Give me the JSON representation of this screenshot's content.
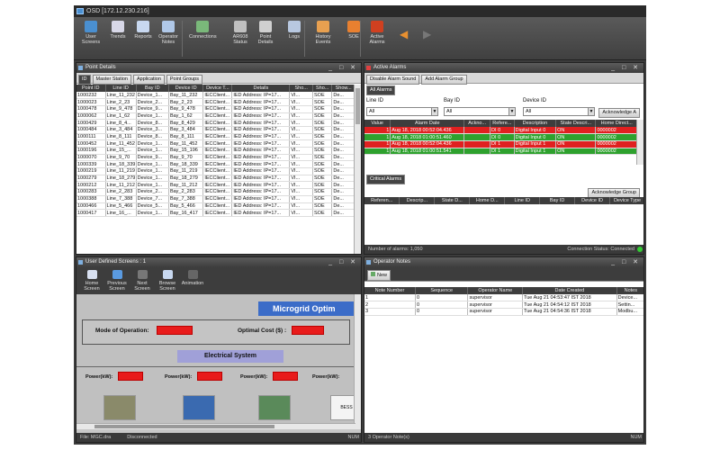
{
  "window": {
    "title": "OSD [172.12.230.216]"
  },
  "toolbar": {
    "items": [
      {
        "label": "User Screens",
        "icon": "user-screens-icon",
        "color": "#4a8fd0"
      },
      {
        "label": "Trends",
        "icon": "trends-icon",
        "color": "#d8d8e8"
      },
      {
        "label": "Reports",
        "icon": "reports-icon",
        "color": "#c8d8f0"
      },
      {
        "label": "Operator Notes",
        "icon": "notes-icon",
        "color": "#b0c8e8"
      },
      {
        "label": "Connections",
        "icon": "connections-icon",
        "color": "#7ab87a"
      },
      {
        "label": "AR608 Status",
        "icon": "status-icon",
        "color": "#c0c0c0"
      },
      {
        "label": "Point Details",
        "icon": "point-details-icon",
        "color": "#d0d0d0"
      },
      {
        "label": "Logs",
        "icon": "logs-icon",
        "color": "#b8c8e0"
      },
      {
        "label": "History Events",
        "icon": "history-icon",
        "color": "#e8a050"
      },
      {
        "label": "SOE",
        "icon": "soe-icon",
        "color": "#e88030"
      },
      {
        "label": "Active Alarms",
        "icon": "alarm-icon",
        "color": "#d04020"
      }
    ]
  },
  "point_details": {
    "title": "Point Details",
    "tabs": [
      "ID",
      "Master Station",
      "Application",
      "Point Groups"
    ],
    "columns": [
      "Point ID",
      "Line ID",
      "Bay ID",
      "Device ID",
      "Device T...",
      "Details",
      "Sho...",
      "Sho...",
      "Show..."
    ],
    "rows": [
      [
        "1000232",
        "Line_11_232",
        "Device_1...",
        "Bay_11_232",
        "IECClient...",
        "IED Address: IP=17...",
        "VI...",
        "SOE",
        "De..."
      ],
      [
        "1000023",
        "Line_2_23",
        "Device_2...",
        "Bay_2_23",
        "IECClient...",
        "IED Address: IP=17...",
        "VI...",
        "SOE",
        "De..."
      ],
      [
        "1000478",
        "Line_9_478",
        "Device_9...",
        "Bay_9_478",
        "IECClient...",
        "IED Address: IP=17...",
        "VI...",
        "SOE",
        "De..."
      ],
      [
        "1000062",
        "Line_1_62",
        "Device_1...",
        "Bay_1_62",
        "IECClient...",
        "IED Address: IP=17...",
        "VI...",
        "SOE",
        "De..."
      ],
      [
        "1000429",
        "Line_8_4...",
        "Device_8...",
        "Bay_8_429",
        "IECClient...",
        "IED Address: IP=17...",
        "VI...",
        "SOE",
        "De..."
      ],
      [
        "1000484",
        "Line_3_484",
        "Device_3...",
        "Bay_3_484",
        "IECClient...",
        "IED Address: IP=17...",
        "VI...",
        "SOE",
        "De..."
      ],
      [
        "1000111",
        "Line_8_111",
        "Device_8...",
        "Bay_8_111",
        "IECClient...",
        "IED Address: IP=17...",
        "VI...",
        "SOE",
        "De..."
      ],
      [
        "1000452",
        "Line_11_452",
        "Device_1...",
        "Bay_11_452",
        "IECClient...",
        "IED Address: IP=17...",
        "VI...",
        "SOE",
        "De..."
      ],
      [
        "1000196",
        "Line_15_...",
        "Device_1...",
        "Bay_15_196",
        "IECClient...",
        "IED Address: IP=17...",
        "VI...",
        "SOE",
        "De..."
      ],
      [
        "1000070",
        "Line_9_70",
        "Device_9...",
        "Bay_9_70",
        "IECClient...",
        "IED Address: IP=17...",
        "VI...",
        "SOE",
        "De..."
      ],
      [
        "1000339",
        "Line_18_339",
        "Device_1...",
        "Bay_18_339",
        "IECClient...",
        "IED Address: IP=17...",
        "VI...",
        "SOE",
        "De..."
      ],
      [
        "1000219",
        "Line_11_219",
        "Device_1...",
        "Bay_11_219",
        "IECClient...",
        "IED Address: IP=17...",
        "VI...",
        "SOE",
        "De..."
      ],
      [
        "1000279",
        "Line_18_279",
        "Device_1...",
        "Bay_18_279",
        "IECClient...",
        "IED Address: IP=17...",
        "VI...",
        "SOE",
        "De..."
      ],
      [
        "1000212",
        "Line_11_212",
        "Device_1...",
        "Bay_11_212",
        "IECClient...",
        "IED Address: IP=17...",
        "VI...",
        "SOE",
        "De..."
      ],
      [
        "1000283",
        "Line_2_283",
        "Device_2...",
        "Bay_2_283",
        "IECClient...",
        "IED Address: IP=17...",
        "VI...",
        "SOE",
        "De..."
      ],
      [
        "1000388",
        "Line_7_388",
        "Device_7...",
        "Bay_7_388",
        "IECClient...",
        "IED Address: IP=17...",
        "VI...",
        "SOE",
        "De..."
      ],
      [
        "1000466",
        "Line_5_466",
        "Device_5...",
        "Bay_5_466",
        "IECClient...",
        "IED Address: IP=17...",
        "VI...",
        "SOE",
        "De..."
      ],
      [
        "1000417",
        "Line_16_...",
        "Device_1...",
        "Bay_16_417",
        "IECClient...",
        "IED Address: IP=17...",
        "VI...",
        "SOE",
        "De..."
      ]
    ]
  },
  "active_alarms": {
    "title": "Active Alarms",
    "buttons": [
      "Disable Alarm Sound",
      "Add Alarm Group"
    ],
    "tab": "All Alarms",
    "filters": [
      {
        "label": "Line ID",
        "value": "All"
      },
      {
        "label": "Bay ID",
        "value": "All"
      },
      {
        "label": "Device ID",
        "value": "All"
      }
    ],
    "ack_all": "Acknowledge A",
    "columns": [
      "Value",
      "Alarm Date",
      "Ackno...",
      "Refere...",
      "Description",
      "State Descri...",
      "Home Direct..."
    ],
    "rows": [
      {
        "value": "1",
        "date": "Aug 18, 2018 00:52:04.436",
        "ack": "",
        "ref": "DI 0",
        "desc": "Digital Input 0",
        "state": "ON",
        "home": "0000002",
        "color": "red"
      },
      {
        "value": "1",
        "date": "Aug 18, 2018 01:00:51.460",
        "ack": "",
        "ref": "DI 0",
        "desc": "Digital Input 0",
        "state": "ON",
        "home": "0000002",
        "color": "green"
      },
      {
        "value": "1",
        "date": "Aug 18, 2018 00:52:04.436",
        "ack": "",
        "ref": "DI 1",
        "desc": "Digital Input 1",
        "state": "ON",
        "home": "0000002",
        "color": "red"
      },
      {
        "value": "1",
        "date": "Aug 18, 2018 01:00:51.541",
        "ack": "",
        "ref": "DI 1",
        "desc": "Digital Input 1",
        "state": "ON",
        "home": "0000002",
        "color": "green"
      }
    ],
    "critical_tab": "Critical Alarms",
    "ack_group": "Acknowledge Group",
    "critical_columns": [
      "Referen...",
      "Descrip...",
      "State D...",
      "Home D...",
      "Line ID",
      "Bay ID",
      "Device ID",
      "Device Type"
    ],
    "count_label": "Number of alarms: 1,050",
    "connection": "Connection Status: Connected"
  },
  "user_screens": {
    "title": "User Defined Screens : 1",
    "nav": [
      {
        "label": "Home Screen",
        "icon": "home-icon"
      },
      {
        "label": "Previous Screen",
        "icon": "previous-icon"
      },
      {
        "label": "Next Screen",
        "icon": "next-icon"
      },
      {
        "label": "Browse Screen",
        "icon": "browse-icon"
      },
      {
        "label": "Animation",
        "icon": "animation-icon"
      }
    ],
    "banner": "Microgrid Optim",
    "mode_label": "Mode of Operation:",
    "cost_label": "Optimal Cost ($) :",
    "electrical": "Electrical System",
    "power_labels": [
      "Power(kW):",
      "Power(kW):",
      "Power(kW):",
      "Power(kW):"
    ],
    "unit_label": "BESS",
    "status": [
      "File: MGC.dra",
      "Disconnected"
    ],
    "status_right": "NUM"
  },
  "operator_notes": {
    "title": "Operator Notes",
    "new_label": "New",
    "columns": [
      "Note Number",
      "Sequence",
      "Operator Name",
      "Date Created",
      "Notes"
    ],
    "rows": [
      [
        "1",
        "0",
        "supervisor",
        "Tue Aug 21 04:53:47 IST 2018",
        "Device..."
      ],
      [
        "2",
        "0",
        "supervisor",
        "Tue Aug 21 04:54:12 IST 2018",
        "Settin..."
      ],
      [
        "3",
        "0",
        "supervisor",
        "Tue Aug 21 04:54:36 IST 2018",
        "Modbu..."
      ]
    ],
    "status": "3 Operator Note(s)",
    "status_right": "NUM"
  }
}
